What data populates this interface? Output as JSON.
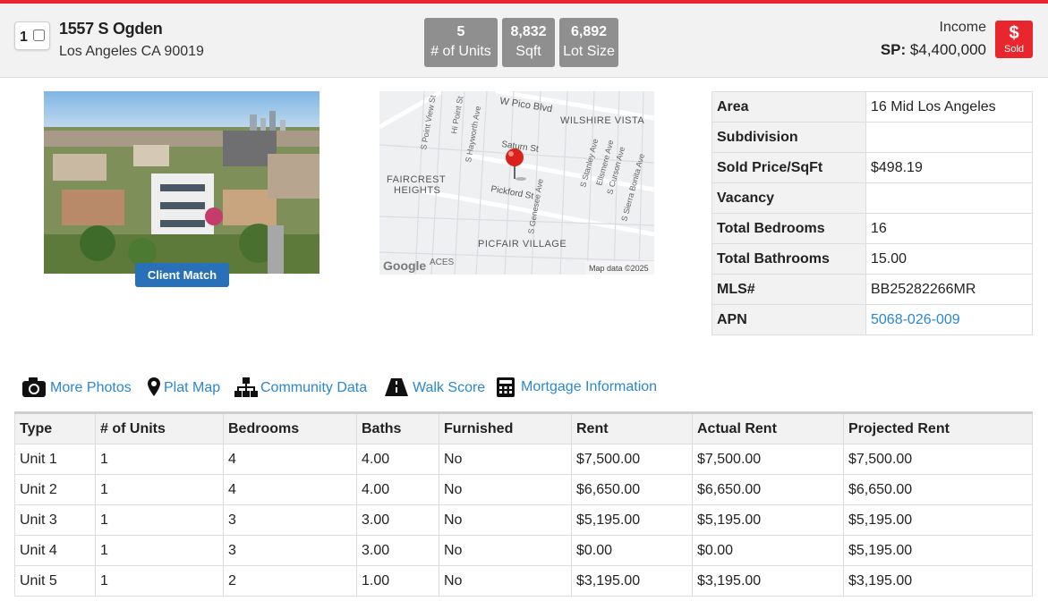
{
  "listing": {
    "index": "1",
    "address_line1": "1557 S Ogden",
    "address_line2": "Los Angeles CA 90019",
    "property_type": "Income",
    "sp_label": "SP:",
    "sp_value": "$4,400,000",
    "status_symbol": "$",
    "status_label": "Sold"
  },
  "stats": [
    {
      "value": "5",
      "label": "# of Units"
    },
    {
      "value": "8,832",
      "label": "Sqft"
    },
    {
      "value": "6,892",
      "label": "Lot Size"
    }
  ],
  "photo": {
    "button_label": "Client Match"
  },
  "map": {
    "labels": {
      "w_pico": "W Pico Blvd",
      "wilshire_vista": "WILSHIRE VISTA",
      "saturn": "Saturn St",
      "faircrest1": "FAIRCREST",
      "faircrest2": "HEIGHTS",
      "pickford": "Pickford St",
      "picfair": "PICFAIR VILLAGE",
      "s_point_view": "S Point View St",
      "hi_point": "Hi Point St",
      "s_hayworth": "S Hayworth Ave",
      "s_genesee": "S Genesee Ave",
      "s_stanley": "S Stanley Ave",
      "ellsmere": "Ellsmere Ave",
      "s_curson": "S Curson Ave",
      "s_sierra_bonita": "S Sierra Bonita Ave",
      "aces": "ACES",
      "google": "Google",
      "attribution": "Map data ©2025"
    }
  },
  "facts": [
    {
      "label": "Area",
      "value": "16 Mid Los Angeles",
      "link": false
    },
    {
      "label": "Subdivision",
      "value": "",
      "link": false
    },
    {
      "label": "Sold Price/SqFt",
      "value": "$498.19",
      "link": false
    },
    {
      "label": "Vacancy",
      "value": "",
      "link": false
    },
    {
      "label": "Total Bedrooms",
      "value": "16",
      "link": false
    },
    {
      "label": "Total Bathrooms",
      "value": "15.00",
      "link": false
    },
    {
      "label": "MLS#",
      "value": "BB25282266MR",
      "link": false
    },
    {
      "label": "APN",
      "value": "5068-026-009",
      "link": true
    }
  ],
  "links": [
    {
      "label": "More Photos",
      "icon": "camera-icon"
    },
    {
      "label": "Plat Map",
      "icon": "map-pin-icon"
    },
    {
      "label": "Community Data",
      "icon": "sitemap-icon"
    },
    {
      "label": "Walk Score",
      "icon": "road-icon"
    },
    {
      "label": "Mortgage Information",
      "icon": "calculator-icon"
    }
  ],
  "units_table": {
    "headers": [
      "Type",
      "# of Units",
      "Bedrooms",
      "Baths",
      "Furnished",
      "Rent",
      "Actual Rent",
      "Projected Rent"
    ],
    "rows": [
      [
        "Unit 1",
        "1",
        "4",
        "4.00",
        "No",
        "$7,500.00",
        "$7,500.00",
        "$7,500.00"
      ],
      [
        "Unit 2",
        "1",
        "4",
        "4.00",
        "No",
        "$6,650.00",
        "$6,650.00",
        "$6,650.00"
      ],
      [
        "Unit 3",
        "1",
        "3",
        "3.00",
        "No",
        "$5,195.00",
        "$5,195.00",
        "$5,195.00"
      ],
      [
        "Unit 4",
        "1",
        "3",
        "3.00",
        "No",
        "$0.00",
        "$0.00",
        "$5,195.00"
      ],
      [
        "Unit 5",
        "1",
        "2",
        "1.00",
        "No",
        "$3,195.00",
        "$3,195.00",
        "$3,195.00"
      ]
    ]
  },
  "colors": {
    "accent_red": "#e8262d",
    "link_blue": "#2a87d0",
    "stat_gray": "#8f8f8f",
    "button_blue": "#2870b7"
  }
}
